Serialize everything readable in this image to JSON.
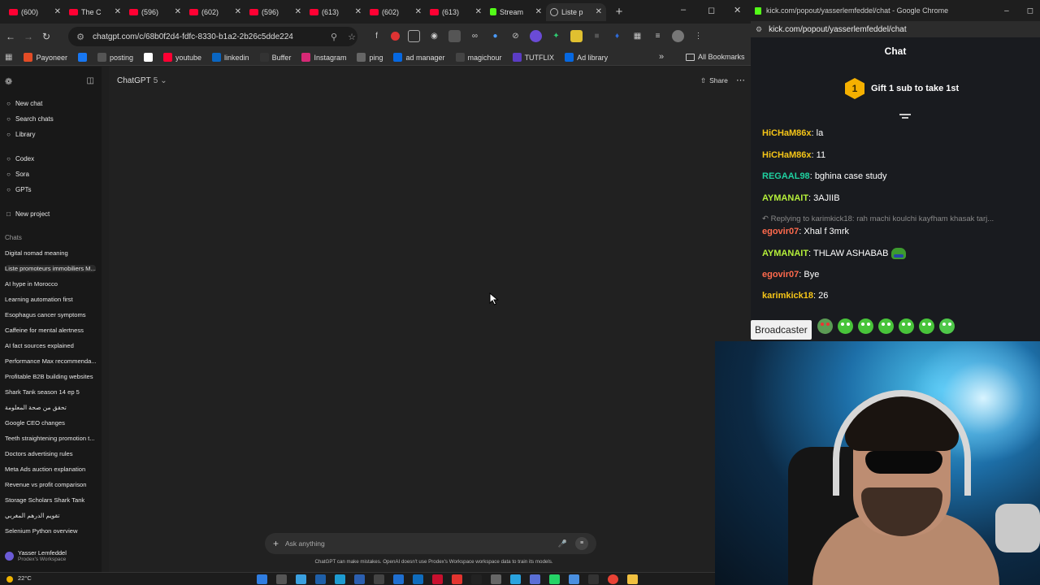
{
  "browser": {
    "tabs": [
      {
        "label": "(600)",
        "type": "youtube",
        "active": false
      },
      {
        "label": "The C",
        "type": "youtube",
        "active": false
      },
      {
        "label": "(596)",
        "type": "youtube",
        "active": false
      },
      {
        "label": "(602)",
        "type": "youtube",
        "active": false
      },
      {
        "label": "(596)",
        "type": "youtube",
        "active": false
      },
      {
        "label": "(613)",
        "type": "youtube",
        "active": false
      },
      {
        "label": "(602)",
        "type": "youtube",
        "active": false
      },
      {
        "label": "(613)",
        "type": "youtube",
        "active": false
      },
      {
        "label": "Stream",
        "type": "kick",
        "active": false
      },
      {
        "label": "Liste p",
        "type": "chatgpt",
        "active": true
      }
    ],
    "url": "chatgpt.com/c/68b0f2d4-fdfc-8330-b1a2-2b26c5dde224",
    "bookmarks": [
      {
        "label": "Payoneer",
        "icon": "payoneer-icon",
        "color": "#e34c26"
      },
      {
        "label": "",
        "icon": "facebook-icon",
        "color": "#1877f2"
      },
      {
        "label": "posting",
        "icon": "posting-icon",
        "color": "#555555"
      },
      {
        "label": "",
        "icon": "google-icon",
        "color": "#ffffff"
      },
      {
        "label": "youtube",
        "icon": "youtube-icon",
        "color": "#ff0033"
      },
      {
        "label": "linkedin",
        "icon": "linkedin-icon",
        "color": "#0a66c2"
      },
      {
        "label": "Buffer",
        "icon": "buffer-icon",
        "color": "#333333"
      },
      {
        "label": "Instagram",
        "icon": "instagram-icon",
        "color": "#d62976"
      },
      {
        "label": "ping",
        "icon": "ping-icon",
        "color": "#666666"
      },
      {
        "label": "ad manager",
        "icon": "meta-icon",
        "color": "#0668e1"
      },
      {
        "label": "magichour",
        "icon": "magichour-icon",
        "color": "#444444"
      },
      {
        "label": "TUTFLIX",
        "icon": "tutflix-icon",
        "color": "#5b3cc4"
      },
      {
        "label": "Ad library",
        "icon": "meta-icon",
        "color": "#0668e1"
      }
    ],
    "all_bookmarks": "All Bookmarks"
  },
  "chatgpt": {
    "model": "ChatGPT",
    "model_version": "5",
    "share_label": "Share",
    "nav": [
      {
        "label": "New chat",
        "icon": "compose-icon"
      },
      {
        "label": "Search chats",
        "icon": "search-icon"
      },
      {
        "label": "Library",
        "icon": "library-icon"
      }
    ],
    "apps": [
      {
        "label": "Codex",
        "icon": "codex-icon"
      },
      {
        "label": "Sora",
        "icon": "sora-icon"
      },
      {
        "label": "GPTs",
        "icon": "gpts-icon"
      }
    ],
    "new_project": "New project",
    "chats_label": "Chats",
    "chats": [
      "Digital nomad meaning",
      "Liste promoteurs immobiliers M...",
      "AI hype in Morocco",
      "Learning automation first",
      "Esophagus cancer symptoms",
      "Caffeine for mental alertness",
      "AI fact sources explained",
      "Performance Max recommenda...",
      "Profitable B2B building websites",
      "Shark Tank season 14 ep 5",
      "تحقق من صحة المعلومة",
      "Google CEO changes",
      "Teeth straightening promotion t...",
      "Doctors advertising rules",
      "Meta Ads auction explanation",
      "Revenue vs profit comparison",
      "Storage Scholars Shark Tank",
      "تقويم الدرهم المغربي",
      "Selenium Python overview"
    ],
    "selected_chat_index": 1,
    "user_name": "Yasser Lemfeddel",
    "workspace": "Prodex's Workspace",
    "composer_placeholder": "Ask anything",
    "disclaimer": "ChatGPT can make mistakes. OpenAI doesn't use Prodex's Workspace workspace data to train its models."
  },
  "kick": {
    "window_title": "kick.com/popout/yasserlemfeddel/chat - Google Chrome",
    "url": "kick.com/popout/yasserlemfeddel/chat",
    "chat_title": "Chat",
    "gift_number": "1",
    "gift_text": "Gift 1 sub to take 1st",
    "messages": [
      {
        "user": "HiCHaM86x",
        "text": "la",
        "color": "#f5c518"
      },
      {
        "user": "HiCHaM86x",
        "text": "11",
        "color": "#f5c518"
      },
      {
        "user": "REGAAL98",
        "text": "bghina case study",
        "color": "#1fd1a0"
      },
      {
        "user": "AYMANAIT",
        "text": "3AJIIB",
        "color": "#b5f03a"
      },
      {
        "user": "egovir07",
        "text": "Xhal f 3mrk",
        "color": "#ff6a4d"
      },
      {
        "user": "AYMANAIT",
        "text": "THLAW ASHABAB",
        "color": "#b5f03a"
      },
      {
        "user": "egovir07",
        "text": "Bye",
        "color": "#ff6a4d"
      },
      {
        "user": "karimkick18",
        "text": "26",
        "color": "#f5c518"
      }
    ],
    "reply_context": "Replying to karimkick18: rah machi koulchi kayfham khasak tarj...",
    "broadcaster_badge": "Broadcaster"
  },
  "taskbar": {
    "temperature": "22°C"
  }
}
